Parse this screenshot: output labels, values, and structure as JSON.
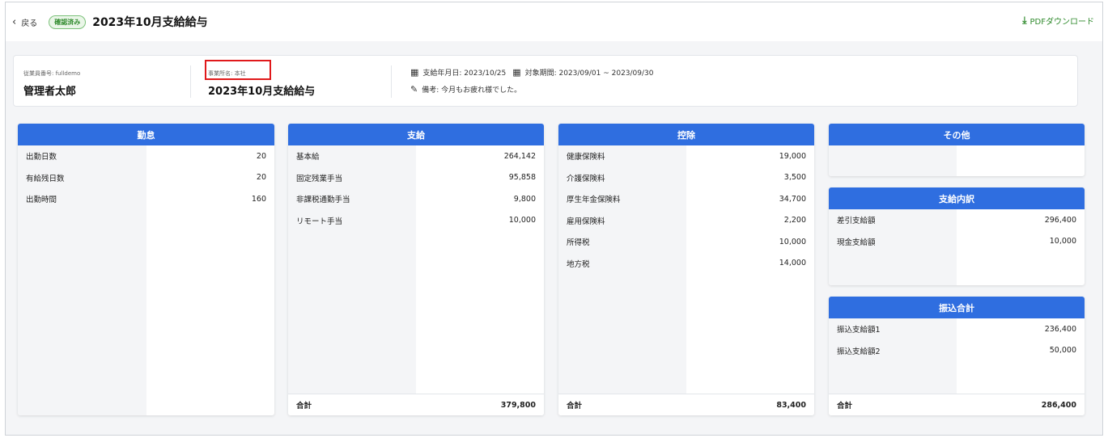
{
  "header": {
    "back_label": "戻る",
    "status_badge": "確認済み",
    "title": "2023年10月支給給与",
    "pdf_label": "PDFダウンロード"
  },
  "info": {
    "employee_no_label": "従業員番号: fulldemo",
    "employee_name": "管理者太郎",
    "office_label": "事業所名: 本社",
    "office_title": "2023年10月支給給与",
    "pay_date": "支給年月日: 2023/10/25",
    "period": "対象期間: 2023/09/01 ~ 2023/09/30",
    "note": "備考: 今月もお疲れ様でした。"
  },
  "panels": {
    "attendance": {
      "title": "勤怠",
      "rows": [
        {
          "label": "出勤日数",
          "value": "20"
        },
        {
          "label": "有給残日数",
          "value": "20"
        },
        {
          "label": "出勤時間",
          "value": "160"
        }
      ]
    },
    "payments": {
      "title": "支給",
      "rows": [
        {
          "label": "基本給",
          "value": "264,142"
        },
        {
          "label": "固定残業手当",
          "value": "95,858"
        },
        {
          "label": "非課税通勤手当",
          "value": "9,800"
        },
        {
          "label": "リモート手当",
          "value": "10,000"
        }
      ],
      "total_label": "合計",
      "total_value": "379,800"
    },
    "deductions": {
      "title": "控除",
      "rows": [
        {
          "label": "健康保険料",
          "value": "19,000"
        },
        {
          "label": "介護保険料",
          "value": "3,500"
        },
        {
          "label": "厚生年金保険料",
          "value": "34,700"
        },
        {
          "label": "雇用保険料",
          "value": "2,200"
        },
        {
          "label": "所得税",
          "value": "10,000"
        },
        {
          "label": "地方税",
          "value": "14,000"
        }
      ],
      "total_label": "合計",
      "total_value": "83,400"
    },
    "other": {
      "title": "その他"
    },
    "breakdown": {
      "title": "支給内訳",
      "rows": [
        {
          "label": "差引支給額",
          "value": "296,400"
        },
        {
          "label": "現金支給額",
          "value": "10,000"
        }
      ]
    },
    "transfer": {
      "title": "振込合計",
      "rows": [
        {
          "label": "振込支給額1",
          "value": "236,400"
        },
        {
          "label": "振込支給額2",
          "value": "50,000"
        }
      ],
      "total_label": "合計",
      "total_value": "286,400"
    }
  },
  "colors": {
    "accent": "#2f6ee0",
    "confirmed_green": "#2f8a2c",
    "highlight_red": "#e0191b"
  }
}
